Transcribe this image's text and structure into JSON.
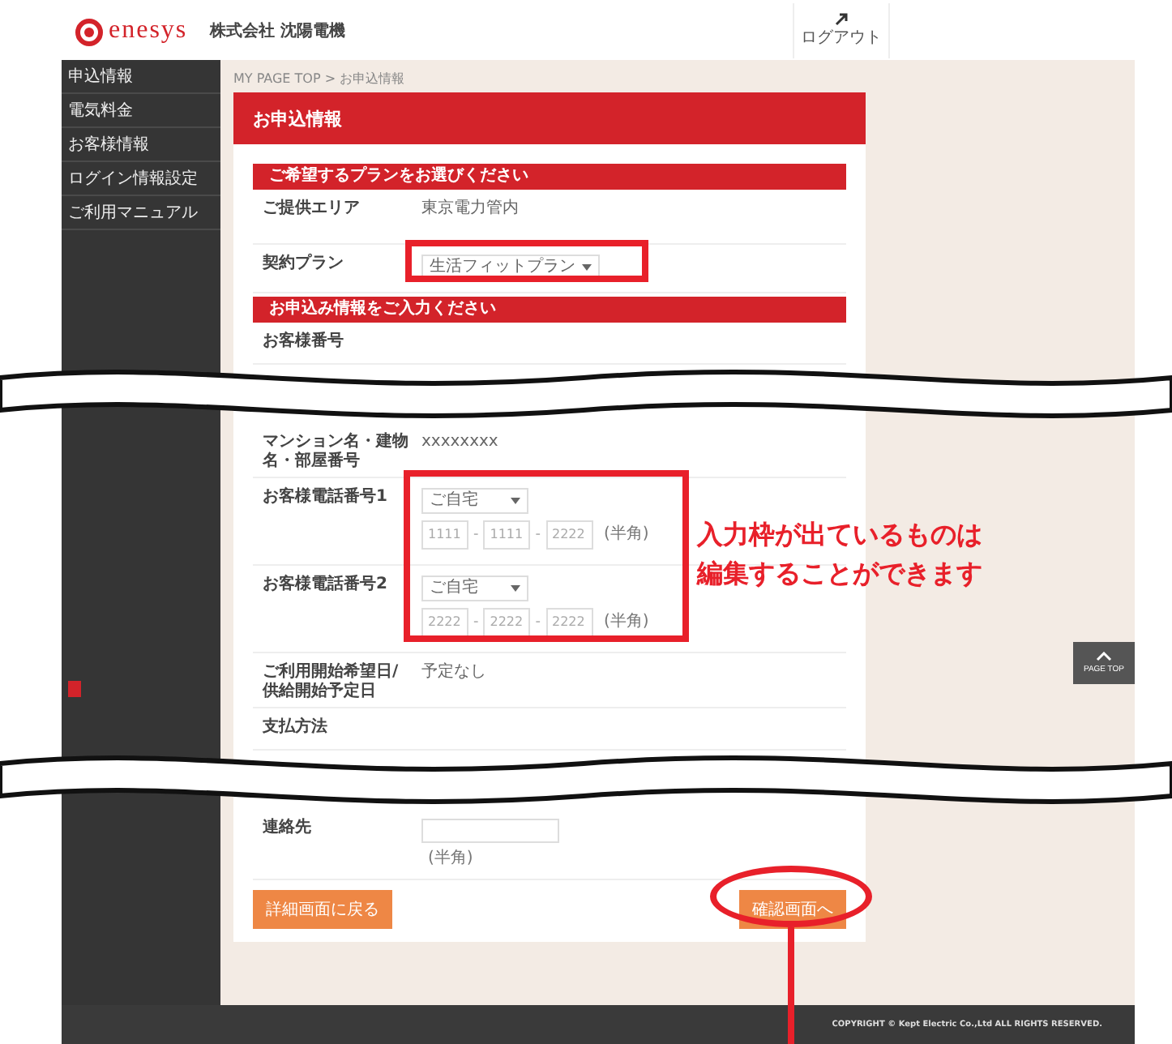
{
  "header": {
    "logo_text": "enesys",
    "company": "株式会社 沈陽電機",
    "logout": "ログアウト"
  },
  "sidebar": {
    "items": [
      "申込情報",
      "電気料金",
      "お客様情報",
      "ログイン情報設定",
      "ご利用マニュアル"
    ]
  },
  "breadcrumb": "MY PAGE TOP > お申込情報",
  "page_title": "お申込情報",
  "sections": [
    {
      "heading": "ご希望するプランをお選びください",
      "rows": [
        {
          "kind": "text",
          "label": "ご提供エリア",
          "value": "東京電力管内"
        },
        {
          "kind": "select",
          "label": "契約プラン",
          "value": "生活フィットプラン"
        }
      ]
    },
    {
      "heading": "お申込み情報をご入力ください",
      "rows": [
        {
          "kind": "text",
          "label": "お客様番号",
          "break_after": true
        },
        {
          "kind": "text",
          "label": "マンション名・建物名・部屋番号",
          "value": "xxxxxxxx"
        },
        {
          "kind": "phone",
          "label": "お客様電話番号1",
          "select": "ご自宅",
          "numbers": [
            "1111",
            "1111",
            "2222"
          ],
          "separator": "-",
          "note": "(半角)"
        },
        {
          "kind": "phone",
          "label": "お客様電話番号2",
          "select": "ご自宅",
          "numbers": [
            "2222",
            "2222",
            "2222"
          ],
          "separator": "-",
          "note": "(半角)"
        },
        {
          "kind": "text",
          "label": "ご利用開始希望日/供給開始予定日",
          "value": "予定なし"
        },
        {
          "kind": "text",
          "label": "支払方法",
          "break_after": true
        },
        {
          "kind": "input",
          "label": "連絡先",
          "note": "(半角)"
        }
      ]
    }
  ],
  "buttons": {
    "back": "詳細画面に戻る",
    "confirm": "確認画面へ"
  },
  "page_top": "PAGE TOP",
  "footer": "COPYRIGHT © Kept Electric Co.,Ltd ALL RIGHTS RESERVED.",
  "annotation": [
    "入力枠が出ているものは",
    "編集することができます"
  ]
}
